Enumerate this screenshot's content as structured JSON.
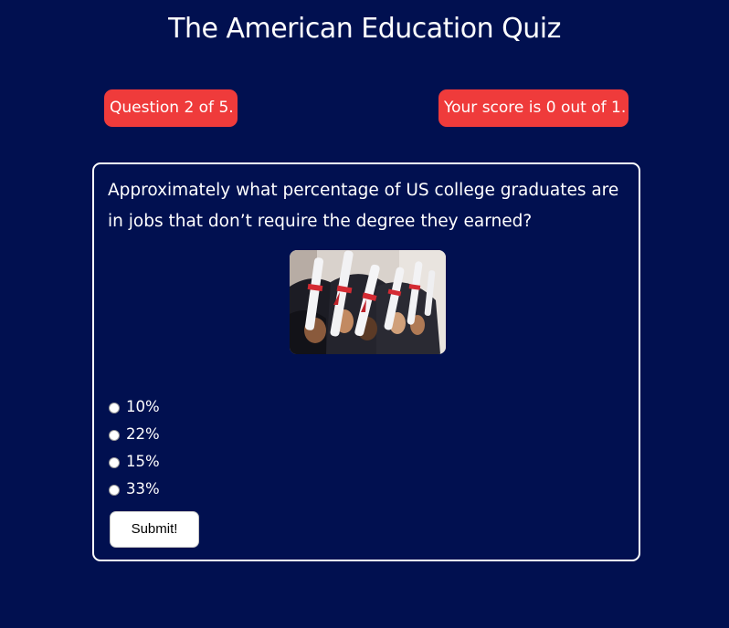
{
  "page": {
    "title": "The American Education Quiz",
    "background_color": "#011050",
    "accent_color": "#ef3b3b"
  },
  "status": {
    "question_counter": "Question 2 of 5.",
    "score": "Your score is 0 out of 1."
  },
  "question": {
    "text": "Approximately what percentage of US college graduates are in jobs that don’t require the degree they earned?",
    "image_subject": "graduates holding rolled diplomas tied with red ribbon",
    "options": [
      {
        "label": "10%",
        "selected": false
      },
      {
        "label": "22%",
        "selected": false
      },
      {
        "label": "15%",
        "selected": false
      },
      {
        "label": "33%",
        "selected": false
      }
    ]
  },
  "actions": {
    "submit_label": "Submit!"
  }
}
